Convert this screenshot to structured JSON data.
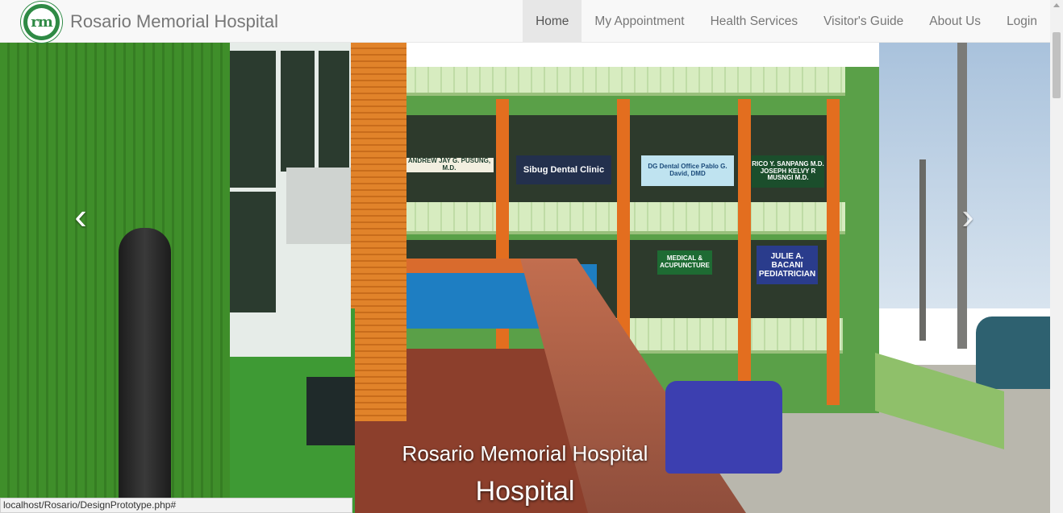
{
  "brand": {
    "logo_text": "rm",
    "title": "Rosario Memorial Hospital"
  },
  "nav": {
    "items": [
      {
        "label": "Home",
        "active": true
      },
      {
        "label": "My Appointment"
      },
      {
        "label": "Health Services"
      },
      {
        "label": "Visitor's Guide"
      },
      {
        "label": "About Us"
      },
      {
        "label": "Login"
      }
    ]
  },
  "carousel": {
    "prev_icon": "chevron-left-icon",
    "next_icon": "chevron-right-icon",
    "caption_title": "Rosario Memorial Hospital",
    "caption_subtitle": "Hospital",
    "signs": {
      "s1": "ANDREW JAY G. PUSUNG, M.D.",
      "s2": "Sibug Dental Clinic",
      "s3": "DG Dental Office Pablo G. David, DMD",
      "s4": "RICO Y. SANPANG M.D. JOSEPH KELVY R MUSNGI M.D.",
      "s5": "JULIE A. BACANI PEDIATRICIAN",
      "s6": "MEDICAL & ACUPUNCTURE"
    }
  },
  "status_bar": {
    "url": "localhost/Rosario/DesignPrototype.php#"
  },
  "colors": {
    "navbar_bg": "#f8f8f8",
    "nav_active_bg": "#e7e7e7",
    "nav_text": "#777777",
    "logo_green": "#2f8a45"
  }
}
